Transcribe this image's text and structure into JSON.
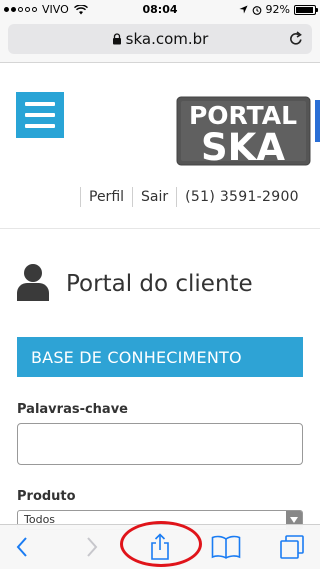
{
  "status_bar": {
    "carrier": "VIVO",
    "time": "08:04",
    "battery": "92%",
    "battery_level": 0.92
  },
  "browser": {
    "url": "ska.com.br"
  },
  "header": {
    "logo_top": "PORTAL",
    "logo_bottom": "SKA",
    "links": {
      "profile": "Perfil",
      "logout": "Sair",
      "phone": "(51) 3591-2900"
    }
  },
  "main": {
    "title": "Portal do cliente",
    "banner": "BASE DE CONHECIMENTO",
    "keywords_label": "Palavras-chave",
    "keywords_value": "",
    "product_label": "Produto",
    "product_selected": "Todos"
  },
  "colors": {
    "accent": "#2ea3d5",
    "annotation": "#e0141a",
    "ios_blue": "#1a7cf3"
  }
}
